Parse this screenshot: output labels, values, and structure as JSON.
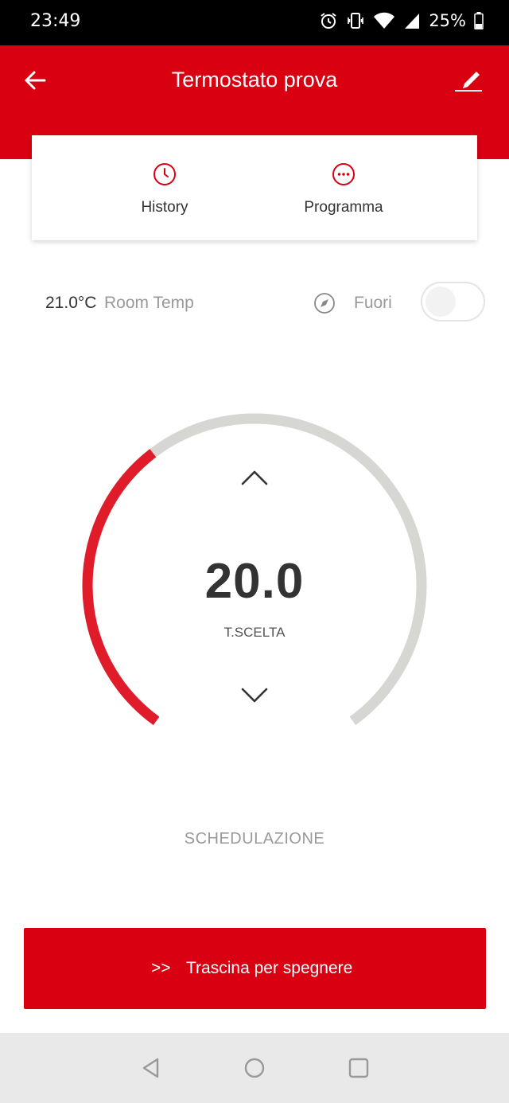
{
  "status_bar": {
    "time": "23:49",
    "battery_percent": "25%",
    "icons": [
      "alarm-icon",
      "vibrate-icon",
      "wifi-icon",
      "signal-icon",
      "battery-icon"
    ]
  },
  "header": {
    "title": "Termostato prova",
    "back_icon": "arrow-left-icon",
    "edit_icon": "pencil-icon"
  },
  "tabs": [
    {
      "label": "History",
      "icon": "clock-icon"
    },
    {
      "label": "Programma",
      "icon": "more-dots-icon"
    }
  ],
  "room": {
    "temperature": "21.0°C",
    "temperature_label": "Room Temp",
    "outside_label": "Fuori",
    "outside_icon": "compass-icon",
    "outside_toggle_on": false
  },
  "thermostat": {
    "set_temperature": "20.0",
    "set_label": "T.SCELTA",
    "dial_fill_fraction": 0.37
  },
  "schedule_label": "SCHEDULAZIONE",
  "slide_action": {
    "arrows": ">>",
    "label": "Trascina per spegnere"
  },
  "colors": {
    "accent": "#d90012",
    "dial_track": "#d6d6d3",
    "dial_active": "#e01c2a"
  },
  "nav_bar": {
    "icons": [
      "nav-back-icon",
      "nav-home-icon",
      "nav-recent-icon"
    ]
  }
}
